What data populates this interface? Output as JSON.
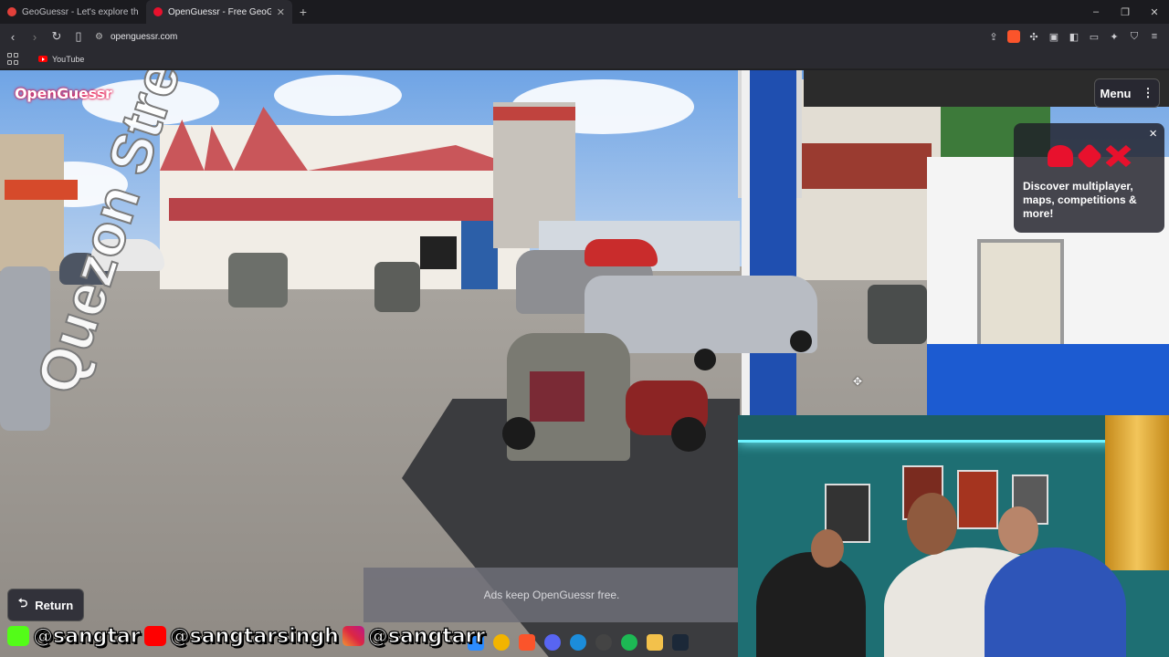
{
  "browser": {
    "tabs": [
      {
        "title": "GeoGuessr - Let's explore the world!",
        "active": false
      },
      {
        "title": "OpenGuessr - Free GeoGuessr",
        "active": true
      }
    ],
    "new_tab": "+",
    "url": "openguessr.com",
    "bookmarks": [
      {
        "label": "YouTube"
      }
    ]
  },
  "game": {
    "logo": "OpenGuessr",
    "menu_label": "Menu",
    "promo": {
      "close": "×",
      "text": "Discover multiplayer, maps, competitions & more!"
    },
    "street_label": "Quezon Street",
    "return_label": "Return",
    "ads_text": "Ads keep OpenGuessr free."
  },
  "social": {
    "kick": "@sangtar",
    "youtube": "@sangtarsingh",
    "instagram": "@sangtarr"
  },
  "colors": {
    "accent": "#e8112d",
    "chrome_bg": "#2a2a30"
  }
}
